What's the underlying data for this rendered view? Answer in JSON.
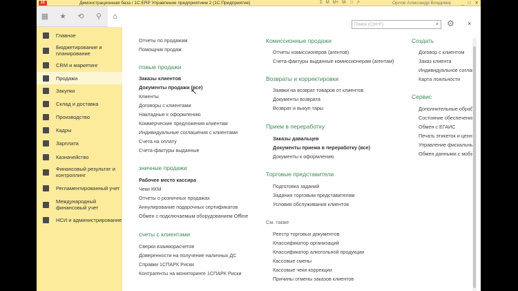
{
  "titlebar": {
    "logo": "1С",
    "title": "Демонстрационная база / 1С:ERP Управление предприятием 2  (1С:Предприятие)",
    "user": "Орлов Александр Владимирович",
    "icons": [
      "Σ",
      "M",
      "M+",
      "M-",
      "□",
      "↗"
    ],
    "window_controls": [
      "_",
      "□",
      "✕"
    ]
  },
  "toolbar": {
    "grid": "▦",
    "star": "★",
    "history": "⟲",
    "search": "⚲",
    "bell": "⍾",
    "home": "⌂"
  },
  "sidebar": {
    "items": [
      {
        "label": "Главное"
      },
      {
        "label": "Бюджетирование и\nпланирование"
      },
      {
        "label": "CRM и маркетинг"
      },
      {
        "label": "Продажи"
      },
      {
        "label": "Закупки"
      },
      {
        "label": "Склад и доставка"
      },
      {
        "label": "Производство"
      },
      {
        "label": "Кадры"
      },
      {
        "label": "Зарплата"
      },
      {
        "label": "Казначейство"
      },
      {
        "label": "Финансовый результат и\nконтроллинг"
      },
      {
        "label": "Регламентированный учет"
      },
      {
        "label": "Международный\nфинансовый учет"
      },
      {
        "label": "НСИ и администрирование"
      }
    ]
  },
  "main": {
    "search_placeholder": "Поиск (Ctrl+F)",
    "search_clear": "×",
    "gear": "⚙",
    "close": "×",
    "col1": [
      {
        "text": "Отчеты по продажам"
      },
      {
        "text": "Помощник продаж"
      },
      {
        "text": "Оптовые продажи"
      },
      {
        "text": "Заказы клиентов"
      },
      {
        "text": "Документы продажи (все)"
      },
      {
        "text": "Клиенты"
      },
      {
        "text": "Договоры с клиентами"
      },
      {
        "text": "Накладные к оформлению"
      },
      {
        "text": "Коммерческие предложения клиентам"
      },
      {
        "text": "Индивидуальные соглашения с клиентами"
      },
      {
        "text": "Счета на оплату"
      },
      {
        "text": "Счета-фактуры выданные"
      },
      {
        "text": "Розничные продажи"
      },
      {
        "text": "Рабочее место кассира"
      },
      {
        "text": "Чеки ККМ"
      },
      {
        "text": "Отчеты о розничных продажах"
      },
      {
        "text": "Аннулирование подарочных сертификатов"
      },
      {
        "text": "Обмен с подключаемым оборудованием Offline"
      },
      {
        "text": "Расчеты с клиентами"
      },
      {
        "text": "Сверки взаиморасчетов"
      },
      {
        "text": "Доверенности на получение наличных ДС"
      },
      {
        "text": "Справки 1СПАРК Риски"
      },
      {
        "text": "Контрагенты на мониторинге 1СПАРК Риски"
      }
    ],
    "col2": [
      {
        "text": "Комиссионные продажи"
      },
      {
        "text": "Отчеты комиссионеров (агентов)"
      },
      {
        "text": "Счета-фактуры выданные комиссионерам (агентам)"
      },
      {
        "text": "Возвраты и корректировки"
      },
      {
        "text": "Заявки на возврат товаров от клиентов"
      },
      {
        "text": "Документы возврата"
      },
      {
        "text": "Возврат и выкуп тары"
      },
      {
        "text": "Прием в переработку"
      },
      {
        "text": "Заказы давальцев"
      },
      {
        "text": "Документы приема в переработку (все)"
      },
      {
        "text": "Документы к оформлению"
      },
      {
        "text": "Торговые представители"
      },
      {
        "text": "Подготовка заданий"
      },
      {
        "text": "Задания торговым представителям"
      },
      {
        "text": "Условия обслуживания клиентов"
      },
      {
        "text": "См. также"
      },
      {
        "text": "Реестр торговых документов"
      },
      {
        "text": "Классификатор организаций"
      },
      {
        "text": "Классификатор алкогольной продукции"
      },
      {
        "text": "Кассовые смены"
      },
      {
        "text": "Кассовые чеки коррекции"
      },
      {
        "text": "Причины отмены заказов клиентов"
      }
    ],
    "col3": [
      {
        "text": "Создать"
      },
      {
        "text": "Договор с клиентом"
      },
      {
        "text": "Заказ клиента"
      },
      {
        "text": "Индивидуальное соглашение"
      },
      {
        "text": "Карта лояльности"
      },
      {
        "text": "Сервис"
      },
      {
        "text": "Дополнительные обработки"
      },
      {
        "text": "Состояние обеспечения"
      },
      {
        "text": "Обмен с ЕГАИС"
      },
      {
        "text": "Печать этикеток и ценников"
      },
      {
        "text": "Управление фискальным"
      },
      {
        "text": "Обмен данными с мобильным"
      }
    ]
  }
}
